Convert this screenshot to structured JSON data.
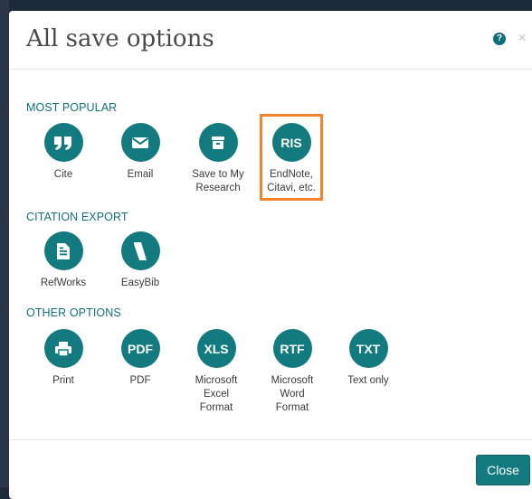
{
  "dialog": {
    "title": "All save options",
    "help_icon_glyph": "?",
    "close_icon_glyph": "×",
    "close_button_label": "Close"
  },
  "sections": {
    "most_popular": {
      "label": "MOST POPULAR",
      "items": [
        {
          "label": "Cite",
          "icon": "quote-icon"
        },
        {
          "label": "Email",
          "icon": "envelope-icon"
        },
        {
          "label": "Save to My\nResearch",
          "icon": "archive-box-icon"
        },
        {
          "label": "EndNote,\nCitavi, etc.",
          "icon_text": "RIS",
          "highlighted": true
        }
      ]
    },
    "citation_export": {
      "label": "CITATION EXPORT",
      "items": [
        {
          "label": "RefWorks",
          "icon": "document-icon"
        },
        {
          "label": "EasyBib",
          "icon": "easybib-logo-icon"
        }
      ]
    },
    "other_options": {
      "label": "OTHER OPTIONS",
      "items": [
        {
          "label": "Print",
          "icon": "printer-icon"
        },
        {
          "label": "PDF",
          "icon_text": "PDF"
        },
        {
          "label": "Microsoft\nExcel\nFormat",
          "icon_text": "XLS"
        },
        {
          "label": "Microsoft\nWord\nFormat",
          "icon_text": "RTF"
        },
        {
          "label": "Text only",
          "icon_text": "TXT"
        }
      ]
    }
  },
  "colors": {
    "accent": "#137a7f",
    "section_label": "#11707a",
    "highlight_border": "#f5832a"
  }
}
